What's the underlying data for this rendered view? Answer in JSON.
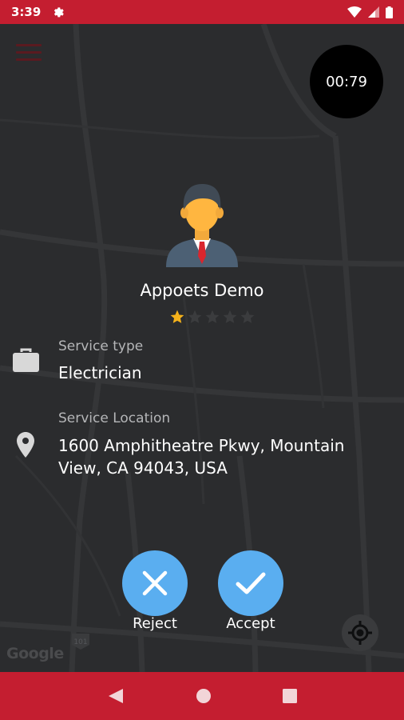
{
  "status_bar": {
    "time": "3:39",
    "icons": [
      "gear-icon",
      "wifi-icon",
      "signal-icon",
      "battery-icon"
    ]
  },
  "colors": {
    "brand_red": "#c41e30",
    "map_background": "#2b2c2e",
    "action_blue": "#5aaef0",
    "star_gold": "#f5b21b"
  },
  "map": {
    "watermark": "Google",
    "road_shield": "101"
  },
  "timer": {
    "value": "00:79"
  },
  "user": {
    "name": "Appoets Demo",
    "rating": 1,
    "rating_max": 5
  },
  "service": {
    "type_label": "Service type",
    "type_value": "Electrician",
    "location_label": "Service Location",
    "location_value": "1600 Amphitheatre Pkwy, Mountain View, CA 94043, USA"
  },
  "actions": {
    "reject_label": "Reject",
    "accept_label": "Accept"
  },
  "nav": {
    "icons": [
      "back-icon",
      "home-icon",
      "recents-icon"
    ]
  }
}
